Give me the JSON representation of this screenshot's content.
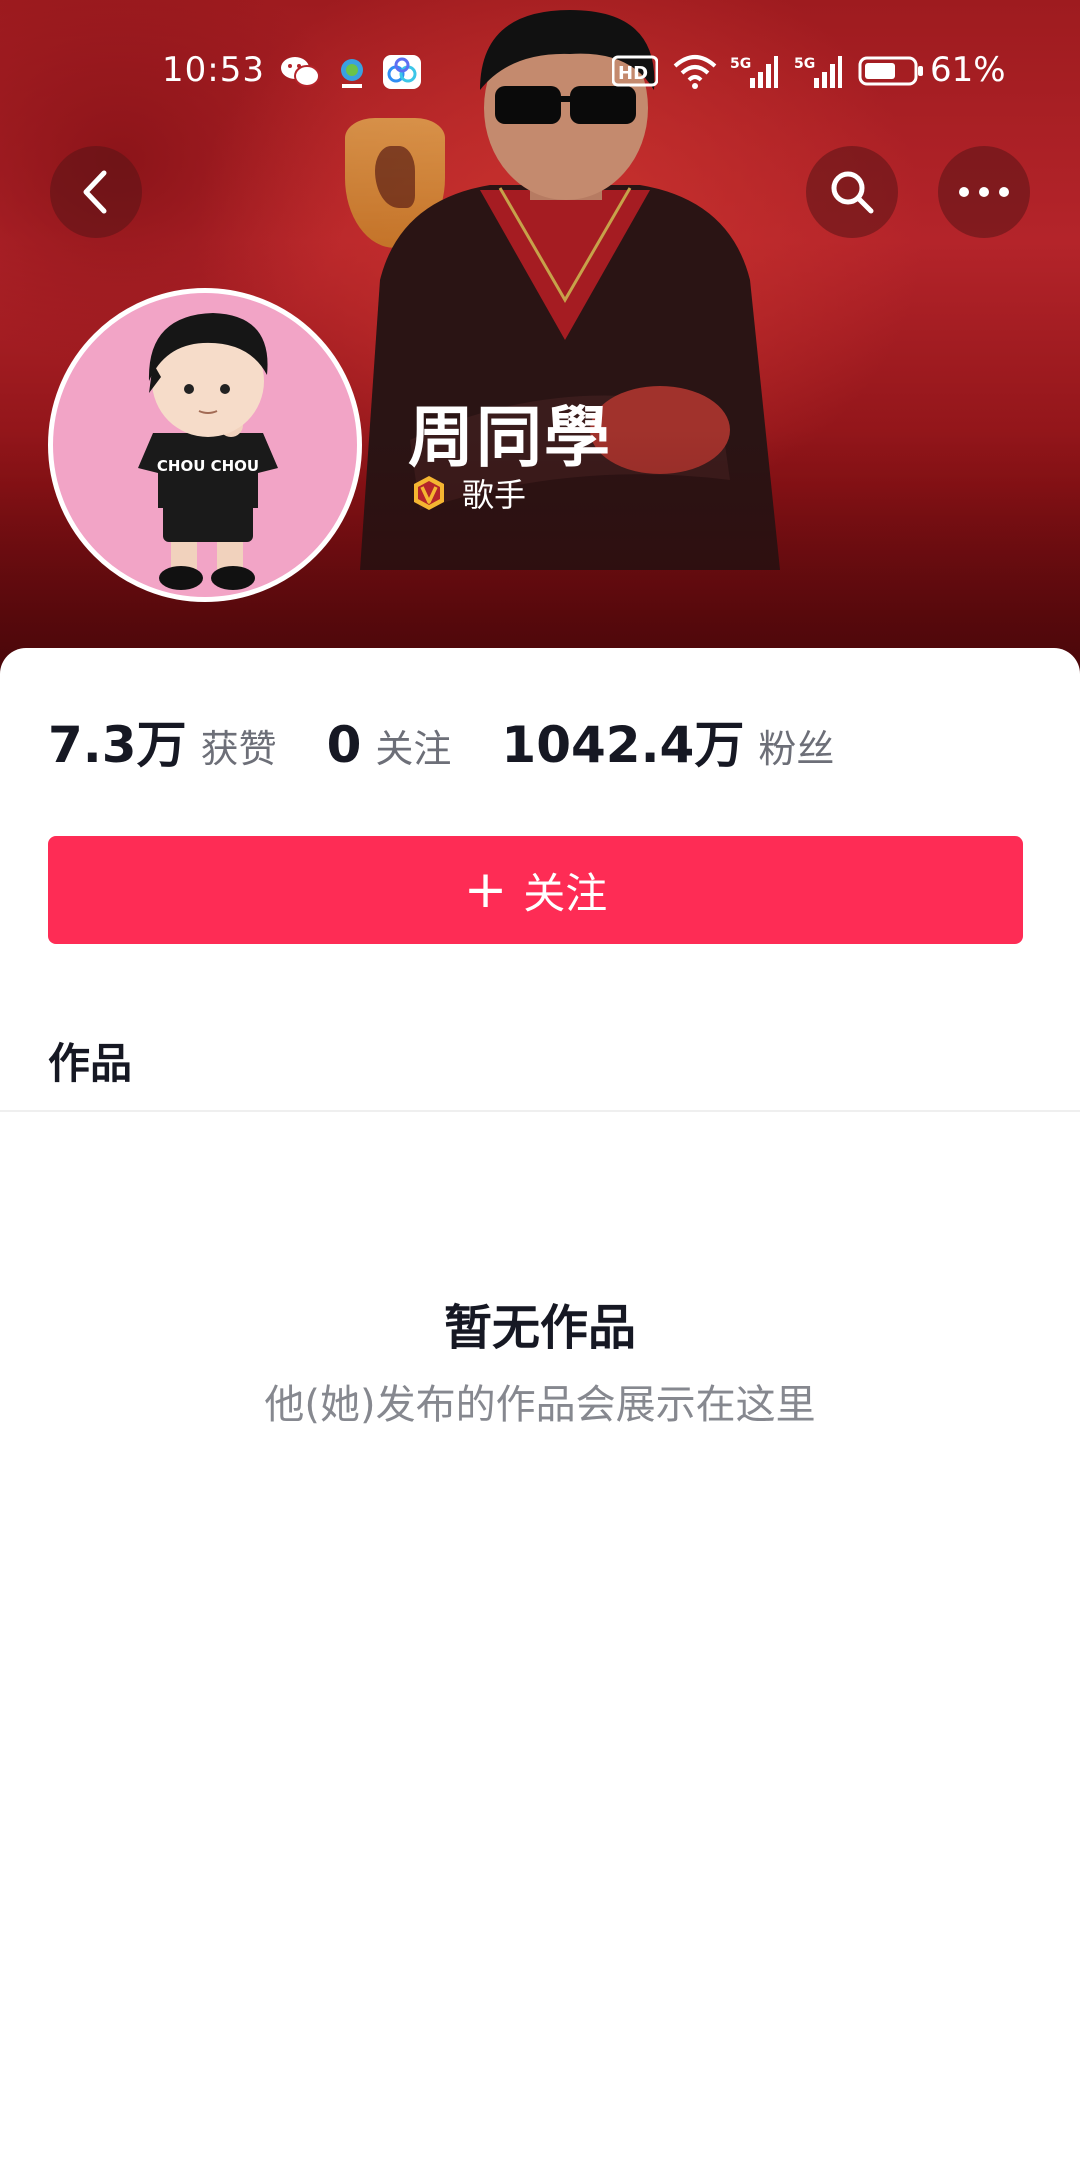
{
  "status_bar": {
    "time": "10:53",
    "icons": [
      "wechat-icon",
      "app-icon",
      "baidu-netdisk-icon",
      "hd-icon",
      "wifi-icon",
      "signal-5g-icon",
      "signal-5g-icon",
      "battery-icon"
    ],
    "hd_label": "HD",
    "network_label_1": "5G",
    "network_label_2": "5G",
    "battery_percent": "61%"
  },
  "header": {
    "back_icon": "chevron-left-icon",
    "search_icon": "search-icon",
    "more_icon": "more-icon"
  },
  "profile": {
    "name": "周同學",
    "role": "歌手",
    "badge_icon": "verified-v-icon",
    "figure_shirt_text": "CHOU CHOU"
  },
  "stats": [
    {
      "value": "7.3万",
      "label": "获赞"
    },
    {
      "value": "0",
      "label": "关注"
    },
    {
      "value": "1042.4万",
      "label": "粉丝"
    }
  ],
  "follow_button": {
    "label": "关注",
    "icon": "plus-icon"
  },
  "tabs": [
    {
      "label": "作品"
    }
  ],
  "empty_state": {
    "title": "暂无作品",
    "subtitle": "他(她)发布的作品会展示在这里"
  },
  "colors": {
    "accent": "#fe2c55",
    "banner_red": "#b4242a",
    "text_primary": "#161823",
    "text_secondary": "#86888f"
  }
}
